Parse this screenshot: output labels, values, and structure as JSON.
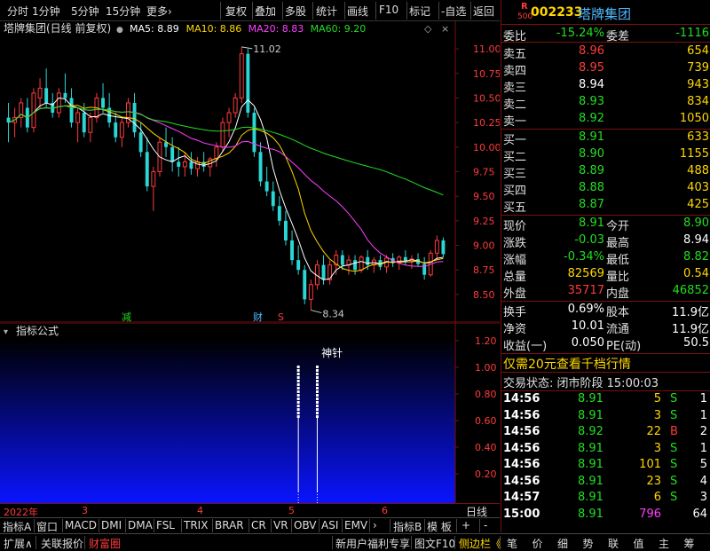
{
  "toolbar": {
    "items": [
      "分时",
      "1分钟",
      "5分钟",
      "15分钟",
      "更多›",
      "复权",
      "叠加",
      "多股",
      "统计",
      "画线",
      "F10",
      "标记",
      "-自选",
      "返回"
    ]
  },
  "chart": {
    "title": "塔牌集团(日线 前复权)",
    "ma": [
      {
        "label": "MA5: 8.89",
        "color": "#ffffff"
      },
      {
        "label": "MA10: 8.86",
        "color": "#ffd700"
      },
      {
        "label": "MA20: 8.83",
        "color": "#ff40ff"
      },
      {
        "label": "MA60: 9.20",
        "color": "#22dd22"
      }
    ],
    "high_label": "11.02",
    "low_label": "8.34",
    "marker_reduce": "减",
    "marker_fin": "财",
    "marker_s": "S",
    "indicator_title": "指标公式",
    "indicator_signal": "神针",
    "date_labels": [
      "2022年",
      "3",
      "4",
      "5",
      "6"
    ],
    "period": "日线"
  },
  "chart_data": {
    "type": "candlestick",
    "y_axis": [
      "11.00",
      "10.75",
      "10.50",
      "10.25",
      "10.00",
      "9.75",
      "9.50",
      "9.25",
      "9.00",
      "8.75",
      "8.50"
    ],
    "ind_axis": [
      "1.20",
      "1.00",
      "0.80",
      "0.60",
      "0.40",
      "0.20"
    ],
    "ylim": [
      8.3,
      11.1
    ],
    "candles": [
      [
        10.3,
        10.45,
        10.05,
        10.25
      ],
      [
        10.25,
        10.4,
        10.1,
        10.3
      ],
      [
        10.3,
        10.5,
        10.2,
        10.45
      ],
      [
        10.4,
        10.5,
        10.15,
        10.2
      ],
      [
        10.2,
        10.6,
        10.15,
        10.55
      ],
      [
        10.5,
        10.7,
        10.4,
        10.6
      ],
      [
        10.6,
        10.8,
        10.4,
        10.45
      ],
      [
        10.45,
        10.55,
        10.3,
        10.35
      ],
      [
        10.35,
        10.6,
        10.3,
        10.55
      ],
      [
        10.55,
        10.75,
        10.45,
        10.5
      ],
      [
        10.5,
        10.6,
        10.2,
        10.25
      ],
      [
        10.25,
        10.4,
        10.05,
        10.35
      ],
      [
        10.35,
        10.45,
        10.1,
        10.15
      ],
      [
        10.15,
        10.35,
        10.05,
        10.3
      ],
      [
        10.3,
        10.55,
        10.25,
        10.5
      ],
      [
        10.5,
        10.65,
        10.35,
        10.4
      ],
      [
        10.4,
        10.55,
        10.2,
        10.25
      ],
      [
        10.25,
        10.35,
        10.05,
        10.1
      ],
      [
        10.1,
        10.3,
        10.0,
        10.25
      ],
      [
        10.25,
        10.5,
        10.2,
        10.45
      ],
      [
        10.45,
        10.55,
        10.1,
        10.15
      ],
      [
        10.15,
        10.25,
        9.9,
        9.95
      ],
      [
        9.95,
        10.1,
        9.55,
        9.6
      ],
      [
        9.6,
        9.8,
        9.35,
        9.75
      ],
      [
        9.75,
        10.1,
        9.7,
        10.05
      ],
      [
        10.05,
        10.2,
        9.9,
        10.0
      ],
      [
        10.0,
        10.1,
        9.75,
        9.85
      ],
      [
        9.85,
        10.0,
        9.7,
        9.8
      ],
      [
        9.8,
        9.95,
        9.7,
        9.85
      ],
      [
        9.85,
        9.95,
        9.72,
        9.78
      ],
      [
        9.78,
        9.9,
        9.7,
        9.85
      ],
      [
        9.85,
        9.95,
        9.75,
        9.8
      ],
      [
        9.8,
        9.9,
        9.7,
        9.88
      ],
      [
        9.88,
        10.05,
        9.8,
        10.0
      ],
      [
        10.0,
        10.3,
        9.95,
        10.25
      ],
      [
        10.25,
        10.4,
        10.1,
        10.35
      ],
      [
        10.35,
        10.55,
        10.3,
        10.5
      ],
      [
        10.5,
        11.02,
        10.45,
        10.95
      ],
      [
        10.95,
        11.0,
        10.3,
        10.35
      ],
      [
        10.35,
        10.4,
        9.9,
        9.95
      ],
      [
        9.95,
        10.05,
        9.6,
        9.65
      ],
      [
        9.65,
        9.8,
        9.5,
        9.55
      ],
      [
        9.55,
        9.65,
        9.35,
        9.4
      ],
      [
        9.4,
        9.5,
        9.2,
        9.25
      ],
      [
        9.25,
        9.35,
        9.0,
        9.05
      ],
      [
        9.05,
        9.15,
        8.8,
        8.85
      ],
      [
        8.85,
        9.0,
        8.7,
        8.75
      ],
      [
        8.75,
        8.8,
        8.4,
        8.45
      ],
      [
        8.45,
        8.65,
        8.34,
        8.6
      ],
      [
        8.6,
        8.85,
        8.55,
        8.8
      ],
      [
        8.8,
        8.9,
        8.6,
        8.65
      ],
      [
        8.65,
        8.85,
        8.6,
        8.8
      ],
      [
        8.8,
        8.95,
        8.7,
        8.9
      ],
      [
        8.9,
        8.95,
        8.75,
        8.8
      ],
      [
        8.8,
        8.9,
        8.7,
        8.85
      ],
      [
        8.85,
        8.9,
        8.7,
        8.75
      ],
      [
        8.75,
        8.9,
        8.72,
        8.88
      ],
      [
        8.88,
        8.95,
        8.75,
        8.8
      ],
      [
        8.8,
        8.88,
        8.72,
        8.85
      ],
      [
        8.85,
        8.9,
        8.75,
        8.78
      ],
      [
        8.78,
        8.9,
        8.72,
        8.87
      ],
      [
        8.87,
        8.92,
        8.78,
        8.82
      ],
      [
        8.82,
        8.9,
        8.75,
        8.88
      ],
      [
        8.88,
        8.95,
        8.8,
        8.84
      ],
      [
        8.84,
        8.9,
        8.76,
        8.86
      ],
      [
        8.86,
        8.92,
        8.78,
        8.81
      ],
      [
        8.81,
        8.88,
        8.65,
        8.7
      ],
      [
        8.7,
        8.95,
        8.68,
        8.92
      ],
      [
        8.92,
        9.1,
        8.85,
        9.05
      ],
      [
        9.05,
        9.08,
        8.88,
        8.91
      ]
    ],
    "signals": [
      {
        "index": 46,
        "value": 1.0
      },
      {
        "index": 49,
        "value": 1.0
      }
    ]
  },
  "quote": {
    "code": "002233",
    "name": "塔牌集团",
    "r_badge": "R",
    "r_sub": "500",
    "weibi_label": "委比",
    "weibi": "-15.24%",
    "weicha_label": "委差",
    "weicha": "-1116",
    "asks": [
      {
        "label": "卖五",
        "price": "8.96",
        "vol": "654",
        "pc": "red"
      },
      {
        "label": "卖四",
        "price": "8.95",
        "vol": "739",
        "pc": "red"
      },
      {
        "label": "卖三",
        "price": "8.94",
        "vol": "943",
        "pc": "white"
      },
      {
        "label": "卖二",
        "price": "8.93",
        "vol": "834",
        "pc": "green"
      },
      {
        "label": "卖一",
        "price": "8.92",
        "vol": "1050",
        "pc": "green"
      }
    ],
    "bids": [
      {
        "label": "买一",
        "price": "8.91",
        "vol": "633",
        "pc": "green"
      },
      {
        "label": "买二",
        "price": "8.90",
        "vol": "1155",
        "pc": "green"
      },
      {
        "label": "买三",
        "price": "8.89",
        "vol": "488",
        "pc": "green"
      },
      {
        "label": "买四",
        "price": "8.88",
        "vol": "403",
        "pc": "green"
      },
      {
        "label": "买五",
        "price": "8.87",
        "vol": "425",
        "pc": "green"
      }
    ],
    "stats": [
      {
        "l1": "现价",
        "v1": "8.91",
        "c1": "green",
        "l2": "今开",
        "v2": "8.90",
        "c2": "green"
      },
      {
        "l1": "涨跌",
        "v1": "-0.03",
        "c1": "green",
        "l2": "最高",
        "v2": "8.94",
        "c2": "white"
      },
      {
        "l1": "涨幅",
        "v1": "-0.34%",
        "c1": "green",
        "l2": "最低",
        "v2": "8.82",
        "c2": "green"
      },
      {
        "l1": "总量",
        "v1": "82569",
        "c1": "yellow",
        "l2": "量比",
        "v2": "0.54",
        "c2": "yellow"
      },
      {
        "l1": "外盘",
        "v1": "35717",
        "c1": "red",
        "l2": "内盘",
        "v2": "46852",
        "c2": "green"
      }
    ],
    "stats2": [
      {
        "l1": "换手",
        "v1": "0.69%",
        "l2": "股本",
        "v2": "11.9亿"
      },
      {
        "l1": "净资",
        "v1": "10.01",
        "l2": "流通",
        "v2": "11.9亿"
      },
      {
        "l1": "收益(一)",
        "v1": "0.050",
        "l2": "PE(动)",
        "v2": "50.5"
      }
    ],
    "promo": "仅需20元查看千档行情",
    "status": "交易状态: 闭市阶段 15:00:03",
    "ticks": [
      {
        "time": "14:56",
        "price": "8.91",
        "vol": "5",
        "side": "S",
        "n": "1",
        "vc": "yellow",
        "sc": "green"
      },
      {
        "time": "14:56",
        "price": "8.91",
        "vol": "3",
        "side": "S",
        "n": "1",
        "vc": "yellow",
        "sc": "green"
      },
      {
        "time": "14:56",
        "price": "8.92",
        "vol": "22",
        "side": "B",
        "n": "2",
        "vc": "yellow",
        "sc": "red"
      },
      {
        "time": "14:56",
        "price": "8.91",
        "vol": "3",
        "side": "S",
        "n": "1",
        "vc": "yellow",
        "sc": "green"
      },
      {
        "time": "14:56",
        "price": "8.91",
        "vol": "101",
        "side": "S",
        "n": "5",
        "vc": "yellow",
        "sc": "green"
      },
      {
        "time": "14:56",
        "price": "8.91",
        "vol": "23",
        "side": "S",
        "n": "4",
        "vc": "yellow",
        "sc": "green"
      },
      {
        "time": "14:57",
        "price": "8.91",
        "vol": "6",
        "side": "S",
        "n": "3",
        "vc": "yellow",
        "sc": "green"
      },
      {
        "time": "15:00",
        "price": "8.91",
        "vol": "796",
        "side": "",
        "n": "64",
        "vc": "magenta",
        "sc": "green"
      }
    ]
  },
  "tabs": [
    "指标A",
    "窗口",
    "MACD",
    "DMI",
    "DMA",
    "FSL",
    "TRIX",
    "BRAR",
    "CR",
    "VR",
    "OBV",
    "ASI",
    "EMV",
    "›",
    "指标B",
    "模 板",
    "+",
    "-"
  ],
  "statusbar": {
    "left": [
      "扩展∧",
      "关联报价",
      "财富圈"
    ],
    "right": [
      "新用户福利专享",
      "图文F10",
      "侧边栏《"
    ],
    "side_tabs": [
      "笔",
      "价",
      "细",
      "势",
      "联",
      "值",
      "主",
      "筹"
    ]
  }
}
